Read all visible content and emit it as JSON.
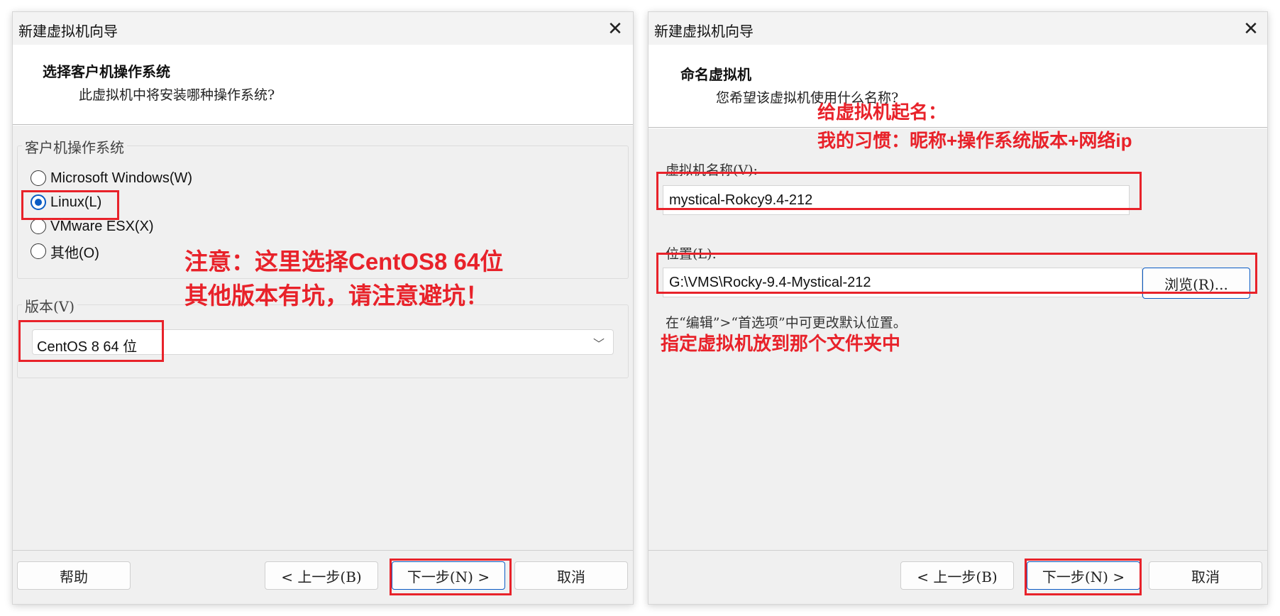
{
  "left_dialog": {
    "title": "新建虚拟机向导",
    "close_symbol": "✕",
    "header_title": "选择客户机操作系统",
    "header_subtitle": "此虚拟机中将安装哪种操作系统?",
    "os_group_label": "客户机操作系统",
    "os_options": [
      {
        "label": "Microsoft Windows(W)",
        "checked": false
      },
      {
        "label": "Linux(L)",
        "checked": true
      },
      {
        "label": "VMware ESX(X)",
        "checked": false
      },
      {
        "label": "其他(O)",
        "checked": false
      }
    ],
    "version_group_label": "版本(V)",
    "version_value": "CentOS 8 64 位",
    "annotation_line1": "注意：这里选择CentOS8 64位",
    "annotation_line2": "其他版本有坑，请注意避坑！",
    "buttons": {
      "help": "帮助",
      "back": "< 上一步(B)",
      "next": "下一步(N) >",
      "cancel": "取消"
    }
  },
  "right_dialog": {
    "title": "新建虚拟机向导",
    "close_symbol": "✕",
    "header_title": "命名虚拟机",
    "header_subtitle": "您希望该虚拟机使用什么名称?",
    "annotation_line1": "给虚拟机起名：",
    "annotation_line2": "我的习惯：昵称+操作系统版本+网络ip",
    "name_label": "虚拟机名称(V):",
    "name_value": "mystical-Rokcy9.4-212",
    "location_label": "位置(L):",
    "location_value": "G:\\VMS\\Rocky-9.4-Mystical-212",
    "browse_label": "浏览(R)...",
    "hint": "在“编辑”>“首选项”中可更改默认位置。",
    "annotation_folder": "指定虚拟机放到那个文件夹中",
    "buttons": {
      "back": "< 上一步(B)",
      "next": "下一步(N) >",
      "cancel": "取消"
    }
  },
  "colors": {
    "annotation": "#e8222a",
    "accent": "#0a5bc4",
    "panel": "#f0f0f0"
  }
}
